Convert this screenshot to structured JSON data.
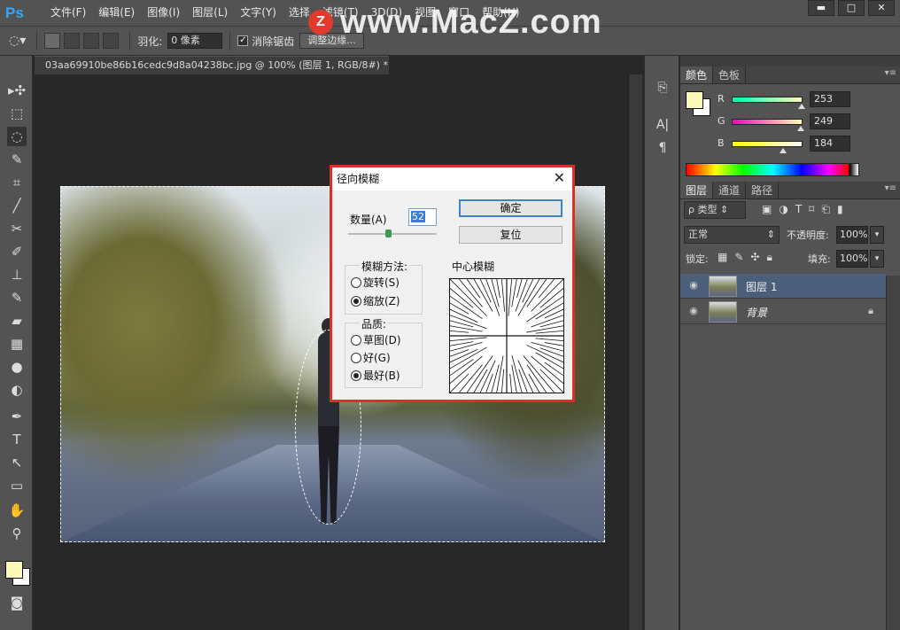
{
  "app": {
    "logo": "Ps",
    "menus": [
      "文件(F)",
      "编辑(E)",
      "图像(I)",
      "图层(L)",
      "文字(Y)",
      "选择",
      "滤镜(T)",
      "3D(D)",
      "视图",
      "窗口",
      "帮助(H)"
    ],
    "window_buttons": [
      "▬",
      "□",
      "✕"
    ],
    "watermark": "www.MacZ.com",
    "watermark_badge": "Z"
  },
  "options": {
    "feather_label": "羽化:",
    "feather_value": "0 像素",
    "antialias_label": "消除锯齿",
    "antialias_checked": true,
    "refine_edge_button": "调整边缘..."
  },
  "document": {
    "tab_title": "03aa69910be86b16cedc9d8a04238bc.jpg @ 100% (图层 1, RGB/8#) *",
    "tab_close": "×"
  },
  "tools": [
    "move-icon",
    "marquee-icon",
    "lasso-icon",
    "quick-select-icon",
    "crop-icon",
    "eyedropper-icon",
    "healing-icon",
    "brush-icon",
    "stamp-icon",
    "history-brush-icon",
    "eraser-icon",
    "gradient-icon",
    "blur-icon",
    "dodge-icon",
    "pen-icon",
    "type-icon",
    "path-select-icon",
    "shape-icon",
    "hand-icon",
    "zoom-icon"
  ],
  "colors": {
    "foreground": "#fdf9b8",
    "background": "#ffffff"
  },
  "color_panel": {
    "tabs": [
      "颜色",
      "色板"
    ],
    "channels": [
      {
        "label": "R",
        "value": "253",
        "fill": 0.99
      },
      {
        "label": "G",
        "value": "249",
        "fill": 0.98
      },
      {
        "label": "B",
        "value": "184",
        "fill": 0.72
      }
    ]
  },
  "layers_panel": {
    "tabs": [
      "图层",
      "通道",
      "路径"
    ],
    "filter_label": "ρ 类型",
    "blend_mode": "正常",
    "opacity_label": "不透明度:",
    "opacity_value": "100%",
    "lock_label": "锁定:",
    "fill_label": "填充:",
    "fill_value": "100%",
    "layers": [
      {
        "name": "图层 1",
        "selected": true
      },
      {
        "name": "背景",
        "selected": false,
        "locked": true
      }
    ]
  },
  "dialog": {
    "title": "径向模糊",
    "amount_label": "数量(A)",
    "amount_value": "52",
    "ok_button": "确定",
    "reset_button": "复位",
    "method_title": "模糊方法:",
    "method_options": [
      {
        "label": "旋转(S)",
        "checked": false
      },
      {
        "label": "缩放(Z)",
        "checked": true
      }
    ],
    "quality_title": "品质:",
    "quality_options": [
      {
        "label": "草图(D)",
        "checked": false
      },
      {
        "label": "好(G)",
        "checked": false
      },
      {
        "label": "最好(B)",
        "checked": true
      }
    ],
    "center_label": "中心模糊"
  }
}
